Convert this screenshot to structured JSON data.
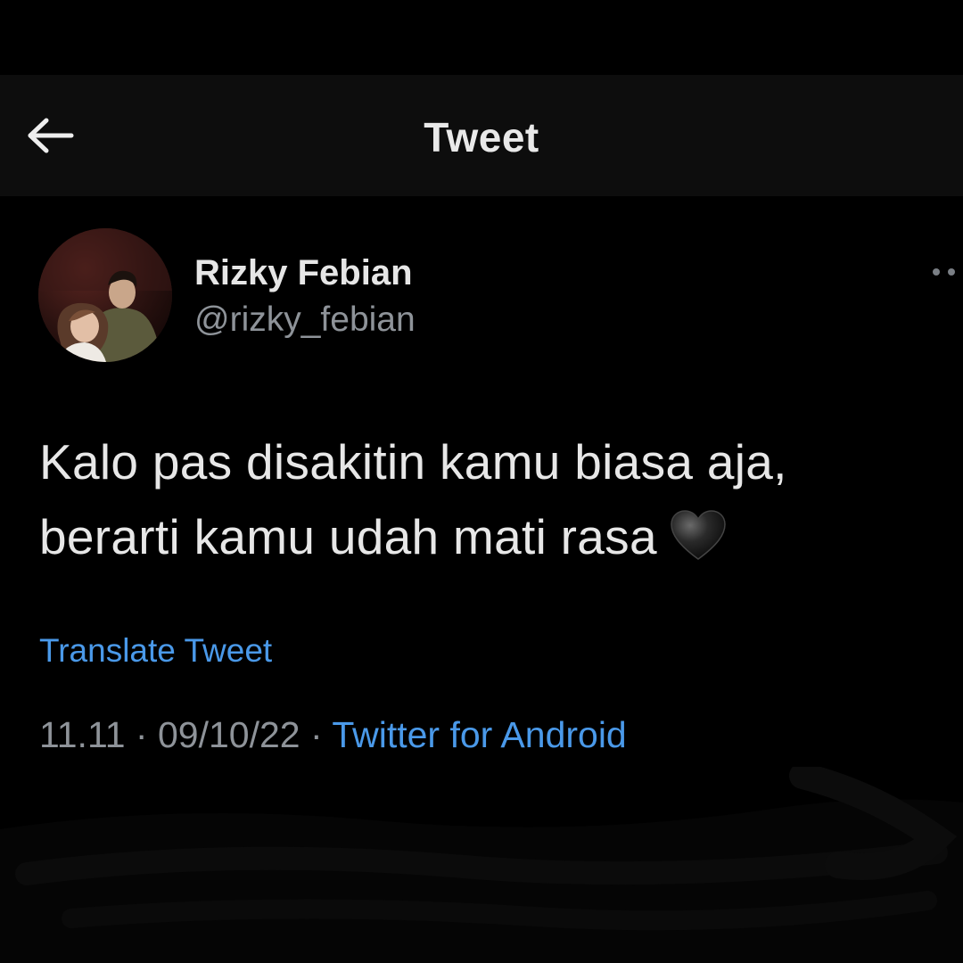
{
  "header": {
    "title": "Tweet",
    "back_icon": "arrow-left-icon"
  },
  "tweet": {
    "author": {
      "display_name": "Rizky Febian",
      "handle": "@rizky_febian",
      "avatar_icon": "profile-photo"
    },
    "more_icon": "more-options-icon",
    "text_lines": [
      "Kalo pas disakitin kamu biasa aja,",
      "berarti kamu udah mati rasa"
    ],
    "emoji": "black-heart-icon",
    "translate_label": "Translate Tweet",
    "meta": {
      "time": "11.11",
      "separator": "·",
      "date": "09/10/22",
      "source": "Twitter for Android"
    }
  },
  "colors": {
    "background": "#000000",
    "header_background": "#0d0d0d",
    "primary_text": "#e7e7e7",
    "secondary_text": "#8e9399",
    "link": "#4a99e9"
  }
}
